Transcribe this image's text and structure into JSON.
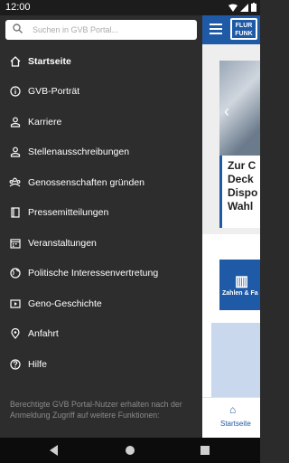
{
  "status": {
    "time": "12:00"
  },
  "search": {
    "placeholder": "Suchen in GVB Portal..."
  },
  "menu": [
    {
      "label": "Startseite",
      "icon": "home-icon"
    },
    {
      "label": "GVB-Porträt",
      "icon": "info-icon"
    },
    {
      "label": "Karriere",
      "icon": "person-icon"
    },
    {
      "label": "Stellenausschreibungen",
      "icon": "person-icon"
    },
    {
      "label": "Genossenschaften gründen",
      "icon": "group-icon"
    },
    {
      "label": "Pressemitteilungen",
      "icon": "book-icon"
    },
    {
      "label": "Veranstaltungen",
      "icon": "calendar-icon"
    },
    {
      "label": "Politische Interessenvertretung",
      "icon": "globe-icon"
    },
    {
      "label": "Geno-Geschichte",
      "icon": "video-icon"
    },
    {
      "label": "Anfahrt",
      "icon": "location-icon"
    },
    {
      "label": "Hilfe",
      "icon": "help-icon"
    }
  ],
  "note": "Berechtigte GVB Portal-Nutzer erhalten nach der Anmeldung Zugriff auf weitere Funktionen:",
  "app": {
    "logo_top": "FLUR",
    "logo_bottom": "FUNK",
    "card_lines": [
      "Zur C",
      "Deck",
      "Dispo",
      "Wahl"
    ],
    "tile_label": "Zahlen & Fa",
    "bottom_label": "Startseite"
  },
  "colors": {
    "drawer_bg": "#2d2d2d",
    "accent": "#1f5aa6"
  }
}
